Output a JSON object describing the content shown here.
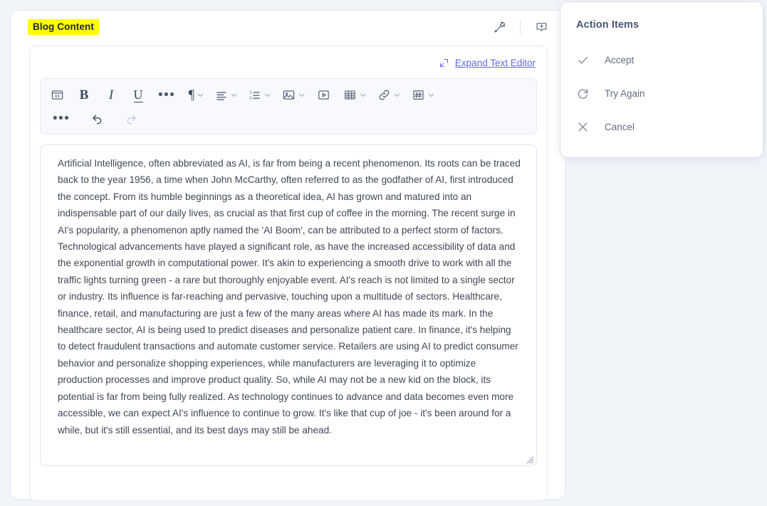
{
  "page": {
    "background_color": "#f1f4f9",
    "card_background": "#ffffff"
  },
  "editor": {
    "field_label": "Blog Content",
    "field_label_highlight": "#ffff00",
    "header_icons": [
      {
        "name": "magic-wand-icon",
        "label": "AI Assist"
      },
      {
        "name": "add-comment-icon",
        "label": "Add Comment"
      }
    ],
    "expand": {
      "label": "Expand Text Editor",
      "color": "#6366e8",
      "icon": "expand-icon"
    },
    "toolbar": {
      "row1": [
        {
          "name": "code-block-button",
          "glyph": "code",
          "caret": false
        },
        {
          "name": "bold-button",
          "glyph": "B",
          "caret": false
        },
        {
          "name": "italic-button",
          "glyph": "I",
          "caret": false
        },
        {
          "name": "underline-button",
          "glyph": "U",
          "caret": false
        },
        {
          "name": "more-formats-button",
          "glyph": "dots",
          "caret": false
        },
        {
          "name": "paragraph-style-button",
          "glyph": "pilcrow",
          "caret": true
        },
        {
          "name": "align-button",
          "glyph": "align",
          "caret": true
        },
        {
          "name": "numbered-list-button",
          "glyph": "numlist",
          "caret": true
        },
        {
          "name": "insert-image-button",
          "glyph": "image",
          "caret": true
        },
        {
          "name": "insert-video-button",
          "glyph": "video",
          "caret": false
        },
        {
          "name": "insert-table-button",
          "glyph": "table",
          "caret": true
        },
        {
          "name": "insert-link-button",
          "glyph": "link",
          "caret": true
        },
        {
          "name": "insert-tag-button",
          "glyph": "hash",
          "caret": true
        }
      ],
      "row2": [
        {
          "name": "more-tools-button",
          "glyph": "dots",
          "state": "enabled"
        },
        {
          "name": "undo-button",
          "glyph": "undo",
          "state": "enabled"
        },
        {
          "name": "redo-button",
          "glyph": "redo",
          "state": "disabled"
        }
      ]
    },
    "content": "Artificial Intelligence, often abbreviated as AI, is far from being a recent phenomenon. Its roots can be traced back to the year 1956, a time when John McCarthy, often referred to as the godfather of AI, first introduced the concept. From its humble beginnings as a theoretical idea, AI has grown and matured into an indispensable part of our daily lives, as crucial as that first cup of coffee in the morning. The recent surge in AI's popularity, a phenomenon aptly named the 'AI Boom', can be attributed to a perfect storm of factors. Technological advancements have played a significant role, as have the increased accessibility of data and the exponential growth in computational power. It's akin to experiencing a smooth drive to work with all the traffic lights turning green - a rare but thoroughly enjoyable event. AI's reach is not limited to a single sector or industry. Its influence is far-reaching and pervasive, touching upon a multitude of sectors. Healthcare, finance, retail, and manufacturing are just a few of the many areas where AI has made its mark. In the healthcare sector, AI is being used to predict diseases and personalize patient care. In finance, it's helping to detect fraudulent transactions and automate customer service. Retailers are using AI to predict consumer behavior and personalize shopping experiences, while manufacturers are leveraging it to optimize production processes and improve product quality. So, while AI may not be a new kid on the block, its potential is far from being fully realized. As technology continues to advance and data becomes even more accessible, we can expect AI's influence to continue to grow. It's like that cup of joe - it's been around for a while, but it's still essential, and its best days may still be ahead."
  },
  "action_panel": {
    "title": "Action Items",
    "items": [
      {
        "label": "Accept",
        "icon": "check-icon"
      },
      {
        "label": "Try Again",
        "icon": "refresh-icon"
      },
      {
        "label": "Cancel",
        "icon": "close-icon"
      }
    ]
  }
}
